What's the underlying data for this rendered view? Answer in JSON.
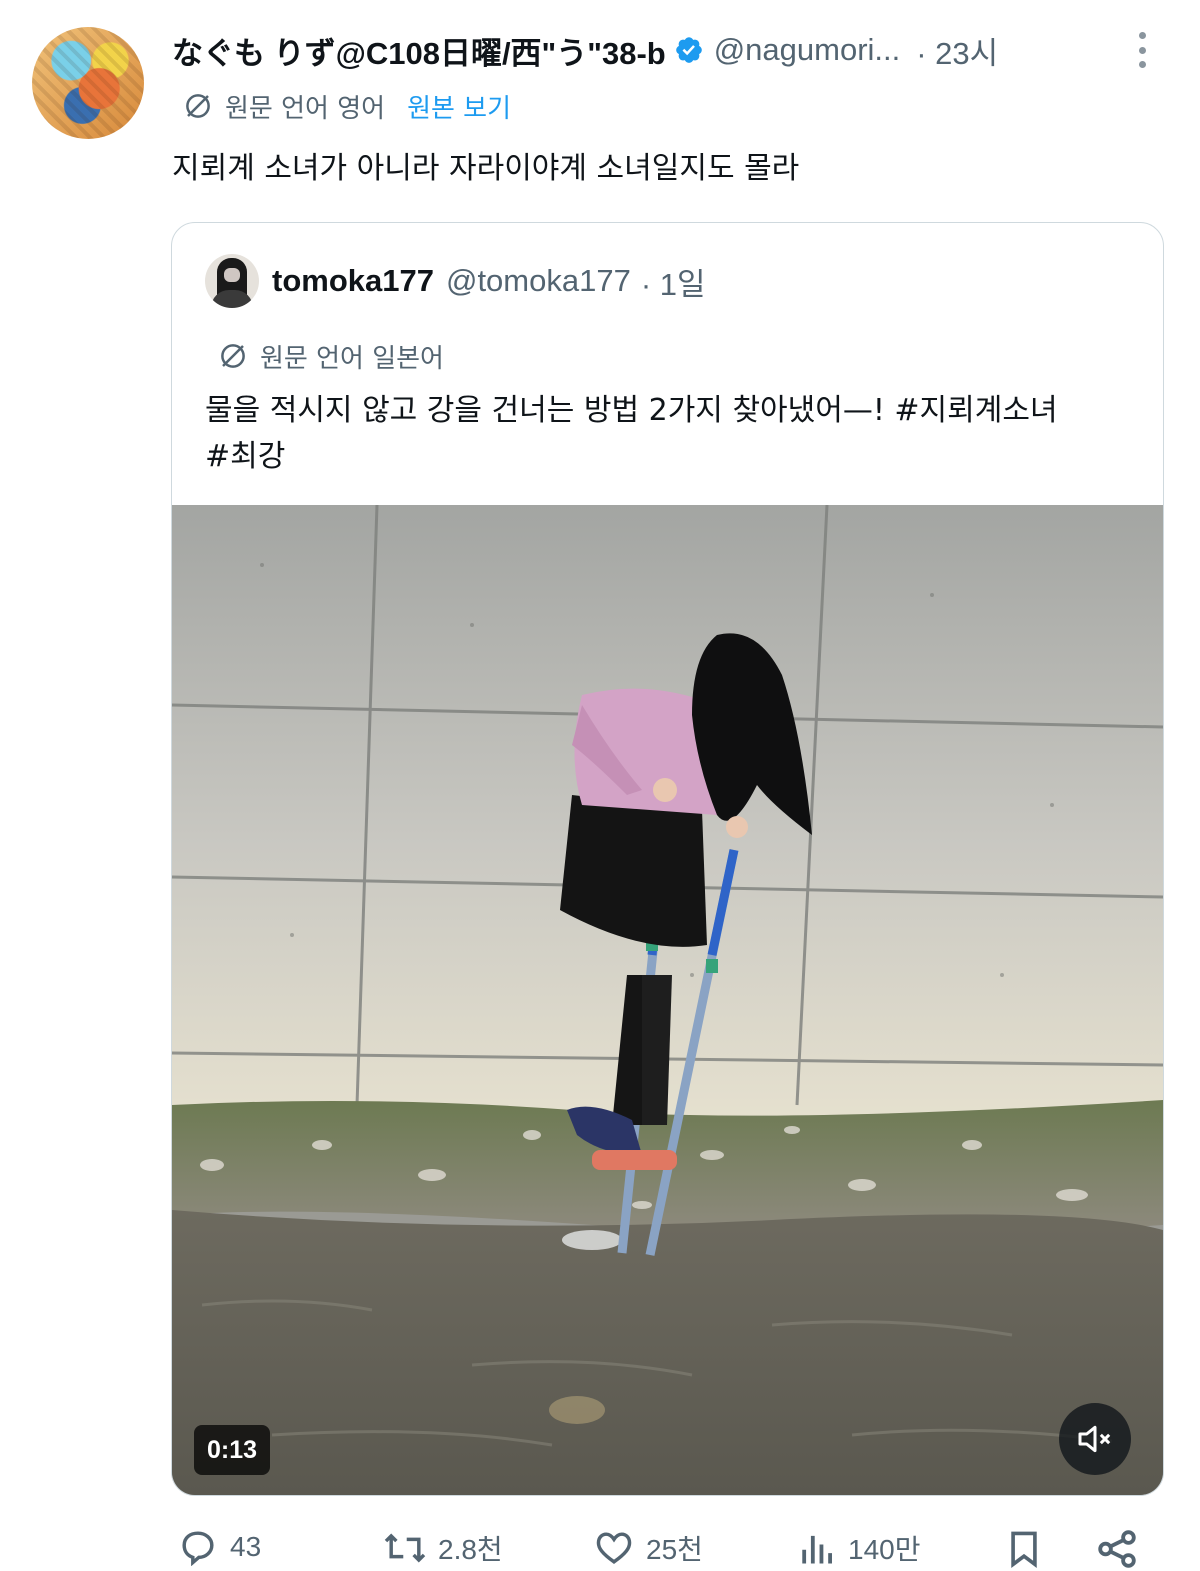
{
  "post": {
    "display_name": "なぐも りず@C108日曜/西\"う\"38-b",
    "handle": "@nagumori...",
    "time": "· 23시",
    "translation_note": "원문 언어 영어",
    "show_original": "원본 보기",
    "text": "지뢰계 소녀가 아니라 자라이야계 소녀일지도 몰라"
  },
  "quote": {
    "display_name": "tomoka177",
    "handle": "@tomoka177",
    "time": "· 1일",
    "translation_note": "원문 언어 일본어",
    "text_line1": "물을 적시지 않고 강을 건너는 방법 2가지 찾아냈어—! #지뢰계소녀",
    "text_line2": "#최강",
    "video": {
      "duration": "0:13",
      "muted": true
    }
  },
  "actions": {
    "replies": "43",
    "reposts": "2.8천",
    "likes": "25천",
    "views": "140만"
  },
  "colors": {
    "accent": "#1d9bf0",
    "secondary_text": "#536471",
    "primary_text": "#0f1419",
    "border": "#cfd9de"
  },
  "icons": [
    "verified-badge-icon",
    "more-icon",
    "translate-icon",
    "mute-icon",
    "reply-icon",
    "repost-icon",
    "like-icon",
    "views-icon",
    "bookmark-icon",
    "share-icon"
  ]
}
